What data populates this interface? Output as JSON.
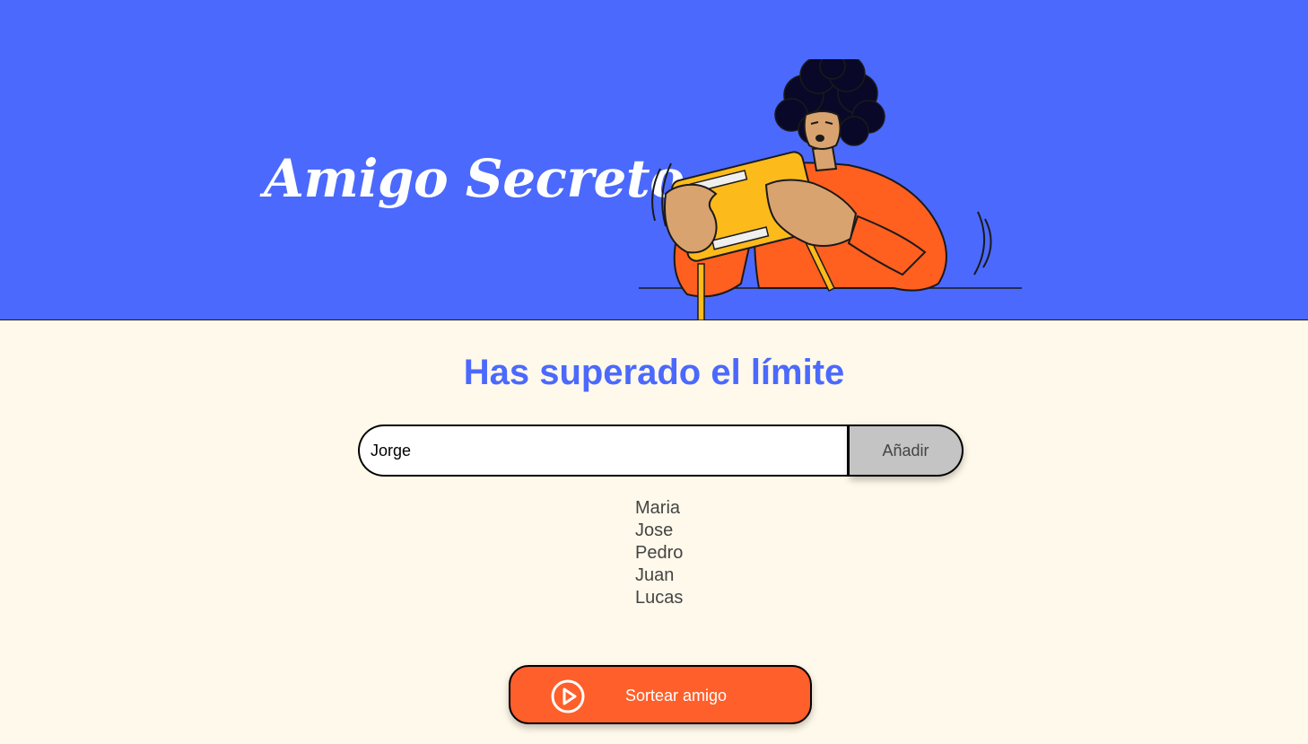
{
  "header": {
    "title": "Amigo Secreto",
    "illustration": "person-shaking-gift-box"
  },
  "main": {
    "title": "Has superado el límite",
    "input": {
      "value": "Jorge",
      "placeholder": ""
    },
    "add_button_label": "Añadir",
    "friends": [
      "Maria",
      "Jose",
      "Pedro",
      "Juan",
      "Lucas"
    ],
    "draw_button_label": "Sortear amigo",
    "draw_button_icon": "play-circle-icon"
  },
  "colors": {
    "header_background": "#4B69FD",
    "page_background": "#FFF9EB",
    "accent_orange": "#FF5F2A",
    "title_blue": "#4B69FD",
    "add_button_gray": "#C4C4C4"
  }
}
